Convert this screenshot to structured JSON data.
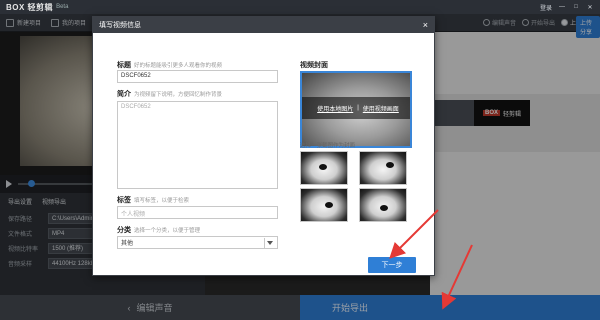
{
  "app": {
    "logo": "BOX 轻剪辑",
    "beta": "Beta",
    "title_right": [
      "登录",
      "—",
      "□",
      "✕"
    ]
  },
  "toolbar": {
    "new_project": "新建项目",
    "my_projects": "我的项目",
    "steps": [
      {
        "label": "编辑声音",
        "active": false
      },
      {
        "label": "开始导出",
        "active": false
      },
      {
        "label": "上传分享",
        "active": true
      }
    ]
  },
  "settings": {
    "head": [
      "导出设置",
      "视频导出"
    ],
    "rows": [
      {
        "label": "保存路径",
        "value": "C:\\Users\\Admini"
      },
      {
        "label": "文件格式",
        "value": "MP4"
      },
      {
        "label": "视频比特率",
        "value": "1500 (推荐)"
      },
      {
        "label": "音频采样",
        "value": "44100Hz 128kbps (推荐)"
      }
    ]
  },
  "right_area": {
    "thumb_label": "轻剪辑",
    "thumb_caption": "的分享",
    "box_caption": "影视",
    "upload": "上传分享"
  },
  "bottom": {
    "back_label": "编辑声音",
    "export_label": "开始导出"
  },
  "dialog": {
    "title": "填写视频信息",
    "close": "×",
    "title_field": {
      "label": "标题",
      "hint": "好的标题能吸引更多人观看你的视频",
      "value": "DSCF0652"
    },
    "intro_field": {
      "label": "简介",
      "hint": "为视频留下说明，方便回忆制作背景",
      "placeholder": "DSCF0652"
    },
    "tags_field": {
      "label": "标签",
      "hint": "填写标签，以便于检索",
      "placeholder": "个人视频"
    },
    "category_field": {
      "label": "分类",
      "hint": "选择一个分类，以便于管理",
      "selected": "其他"
    },
    "cover": {
      "label": "视频封面",
      "use_local": "使用本地图片",
      "separator": "|",
      "use_frame": "使用视频画面",
      "frames_label": "选择一张截图作为封面"
    },
    "next_button": "下一步"
  },
  "colors": {
    "accent_blue": "#2f7fd6",
    "annotation_red": "#e53935",
    "dialog_header": "#3b3f46"
  }
}
